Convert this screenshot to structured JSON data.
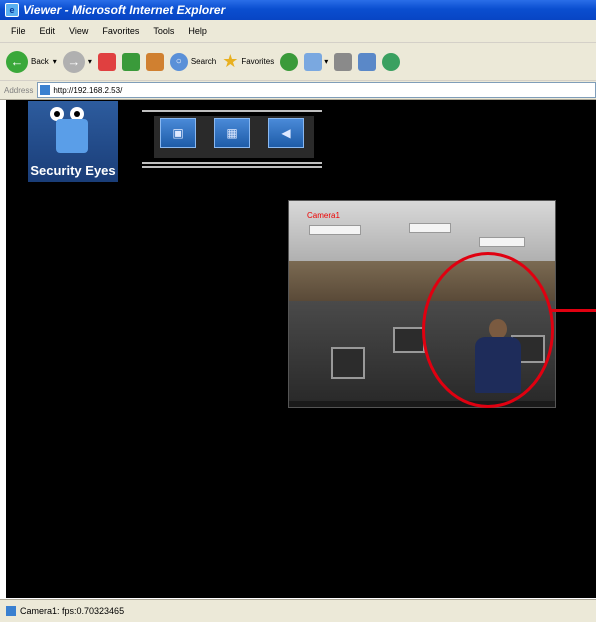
{
  "window": {
    "title": "Viewer - Microsoft Internet Explorer"
  },
  "menu": {
    "items": [
      "File",
      "Edit",
      "View",
      "Favorites",
      "Tools",
      "Help"
    ]
  },
  "toolbar": {
    "back_label": "Back",
    "search_label": "Search",
    "favorites_label": "Favorites"
  },
  "address": {
    "label": "Address",
    "url": "http://192.168.2.53/"
  },
  "logo": {
    "text": "Security Eyes"
  },
  "video": {
    "camera_label": "Camera1"
  },
  "status": {
    "text": "Camera1: fps:0.70323465"
  },
  "colors": {
    "annotation": "#e00010",
    "title_bar": "#0a4ed0",
    "content_bg": "#000000"
  }
}
